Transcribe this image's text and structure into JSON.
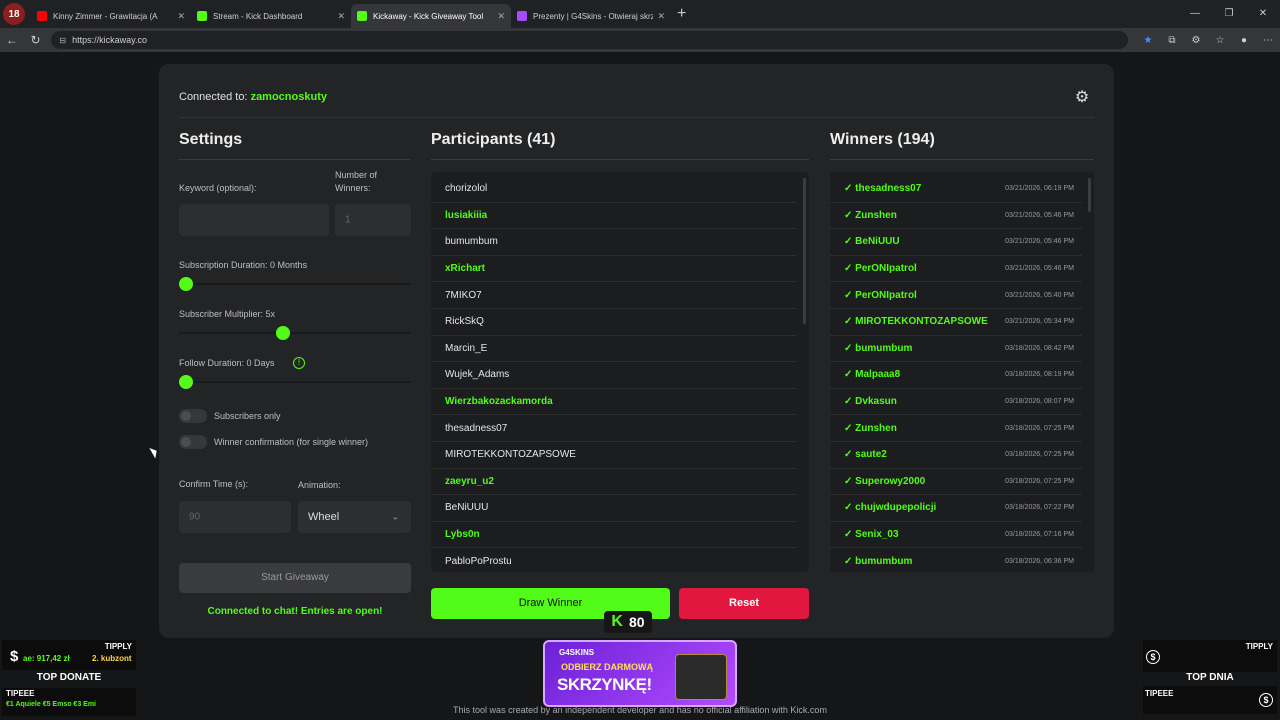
{
  "browser": {
    "app_icon": "18",
    "tabs": [
      {
        "label": "Kinny Zimmer - Grawitacja (A",
        "icon_color": "#ff0000",
        "active": false
      },
      {
        "label": "Stream - Kick Dashboard",
        "icon_color": "#53fc18",
        "active": false
      },
      {
        "label": "Kickaway - Kick Giveaway Tool",
        "icon_color": "#53fc18",
        "active": true
      },
      {
        "label": "Prezenty | G4Skins - Otwieraj skrz",
        "icon_color": "#a64bff",
        "active": false
      }
    ],
    "url": "https://kickaway.co"
  },
  "header": {
    "connected_label": "Connected to: ",
    "channel": "zamocnoskuty"
  },
  "settings": {
    "title": "Settings",
    "keyword_label": "Keyword (optional):",
    "keyword_value": "",
    "winners_label_1": "Number of",
    "winners_label_2": "Winners:",
    "winners_placeholder": "1",
    "subscription_duration_label": "Subscription Duration: 0 Months",
    "subscription_duration_value": 0,
    "subscriber_multiplier_label": "Subscriber Multiplier: 5x",
    "subscriber_multiplier_value": 5,
    "follow_duration_label": "Follow Duration:  0  Days",
    "follow_duration_value": 0,
    "info_glyph": "!",
    "subscribers_only_label": "Subscribers only",
    "subscribers_only_on": false,
    "winner_confirmation_label": "Winner confirmation (for single winner)",
    "winner_confirmation_on": false,
    "confirm_time_label": "Confirm Time (s):",
    "confirm_time_placeholder": "90",
    "animation_label": "Animation:",
    "animation_value": "Wheel",
    "start_button": "Start Giveaway",
    "chat_status": "Connected to chat! Entries are open!"
  },
  "participants": {
    "title": "Participants (41)",
    "items": [
      {
        "name": "chorizolol",
        "sub": false
      },
      {
        "name": "lusiakiiia",
        "sub": true
      },
      {
        "name": "bumumbum",
        "sub": false
      },
      {
        "name": "xRichart",
        "sub": true
      },
      {
        "name": "7MIKO7",
        "sub": false
      },
      {
        "name": "RickSkQ",
        "sub": false
      },
      {
        "name": "Marcin_E",
        "sub": false
      },
      {
        "name": "Wujek_Adams",
        "sub": false
      },
      {
        "name": "Wierzbakozackamorda",
        "sub": true
      },
      {
        "name": "thesadness07",
        "sub": false
      },
      {
        "name": "MIROTEKKONTOZAPSOWE",
        "sub": false
      },
      {
        "name": "zaeyru_u2",
        "sub": true
      },
      {
        "name": "BeNiUUU",
        "sub": false
      },
      {
        "name": "Lybs0n",
        "sub": true
      },
      {
        "name": "PabloPoProstu",
        "sub": false
      }
    ],
    "draw_button": "Draw Winner",
    "reset_button": "Reset"
  },
  "winners": {
    "title": "Winners (194)",
    "items": [
      {
        "name": "✓ thesadness07",
        "date": "03/21/2026, 06:19 PM"
      },
      {
        "name": "✓ Zunshen",
        "date": "03/21/2026, 05:46 PM"
      },
      {
        "name": "✓ BeNiUUU",
        "date": "03/21/2026, 05:46 PM"
      },
      {
        "name": "✓ PerONIpatrol",
        "date": "03/21/2026, 05:46 PM"
      },
      {
        "name": "✓ PerONIpatrol",
        "date": "03/21/2026, 05:40 PM"
      },
      {
        "name": "✓ MIROTEKKONTOZAPSOWE",
        "date": "03/21/2026, 05:34 PM"
      },
      {
        "name": "✓ bumumbum",
        "date": "03/18/2026, 08:42 PM"
      },
      {
        "name": "✓ Malpaaa8",
        "date": "03/18/2026, 08:19 PM"
      },
      {
        "name": "✓ Dvkasun",
        "date": "03/18/2026, 08:07 PM"
      },
      {
        "name": "✓ Zunshen",
        "date": "03/18/2026, 07:25 PM"
      },
      {
        "name": "✓ saute2",
        "date": "03/18/2026, 07:25 PM"
      },
      {
        "name": "✓ Superowy2000",
        "date": "03/18/2026, 07:25 PM"
      },
      {
        "name": "✓ chujwdupepolicji",
        "date": "03/18/2026, 07:22 PM"
      },
      {
        "name": "✓ Senix_03",
        "date": "03/18/2026, 07:16 PM"
      },
      {
        "name": "✓ bumumbum",
        "date": "03/18/2026, 06:36 PM"
      }
    ]
  },
  "footer": "This tool was created by an independent developer and has no official affiliation with Kick.com",
  "overlays": {
    "tipply_left": "TIPPLY",
    "dollar": "$",
    "amount_left": "ae: 917,42 zł",
    "rank_left": "2. kubzont",
    "top_donate": "TOP DONATE",
    "tipeee_left": "TIPEEE",
    "tipeee_entries": "€1 Aquiele   €5 Emso   €3 Emi",
    "tipply_right": "TIPPLY",
    "top_dnia": "TOP DNIA",
    "tipeee_right": "TIPEEE",
    "kick_badge_letter": "K",
    "kick_badge_count": "80",
    "promo_brand": "G4SKINS",
    "promo_line1": "ODBIERZ DARMOWĄ",
    "promo_line2": "SKRZYNKĘ!"
  }
}
